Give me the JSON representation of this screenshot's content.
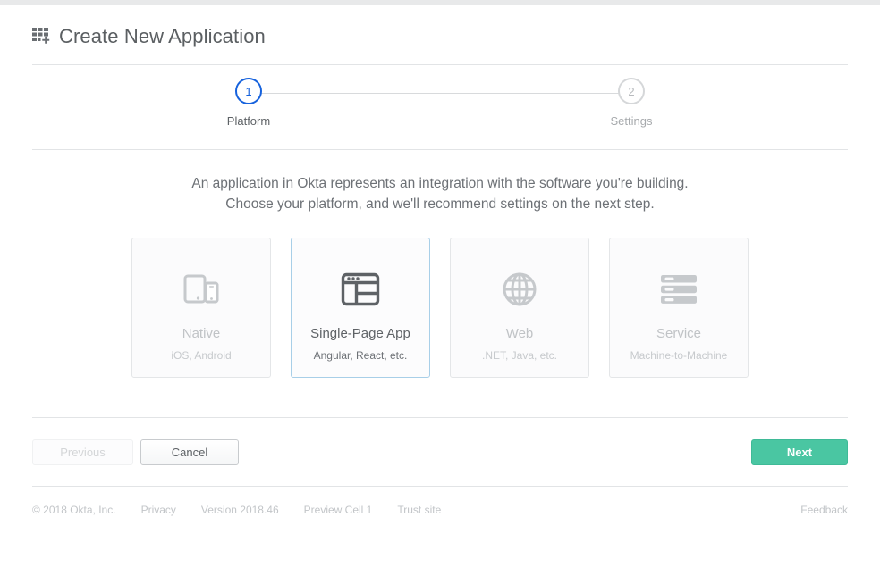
{
  "header": {
    "title": "Create New Application",
    "icon": "grid-plus-icon"
  },
  "stepper": {
    "steps": [
      {
        "number": "1",
        "label": "Platform",
        "state": "active"
      },
      {
        "number": "2",
        "label": "Settings",
        "state": "inactive"
      }
    ]
  },
  "description": {
    "line1": "An application in Okta represents an integration with the software you're building.",
    "line2": "Choose your platform, and we'll recommend settings on the next step."
  },
  "platforms": [
    {
      "title": "Native",
      "subtitle": "iOS, Android",
      "icon": "devices-icon",
      "selected": false
    },
    {
      "title": "Single-Page App",
      "subtitle": "Angular, React, etc.",
      "icon": "browser-window-icon",
      "selected": true
    },
    {
      "title": "Web",
      "subtitle": ".NET, Java, etc.",
      "icon": "globe-icon",
      "selected": false
    },
    {
      "title": "Service",
      "subtitle": "Machine-to-Machine",
      "icon": "server-stack-icon",
      "selected": false
    }
  ],
  "actions": {
    "previous_label": "Previous",
    "cancel_label": "Cancel",
    "next_label": "Next"
  },
  "footer": {
    "copyright": "© 2018 Okta, Inc.",
    "privacy": "Privacy",
    "version": "Version 2018.46",
    "cell": "Preview Cell 1",
    "trust": "Trust site",
    "feedback": "Feedback"
  },
  "colors": {
    "accent_blue": "#1662dd",
    "selected_border": "#a8cfe8",
    "next_green": "#4ac6a2",
    "text": "#5e6266",
    "muted": "#c0c3c6",
    "divider": "#e2e4e6"
  }
}
